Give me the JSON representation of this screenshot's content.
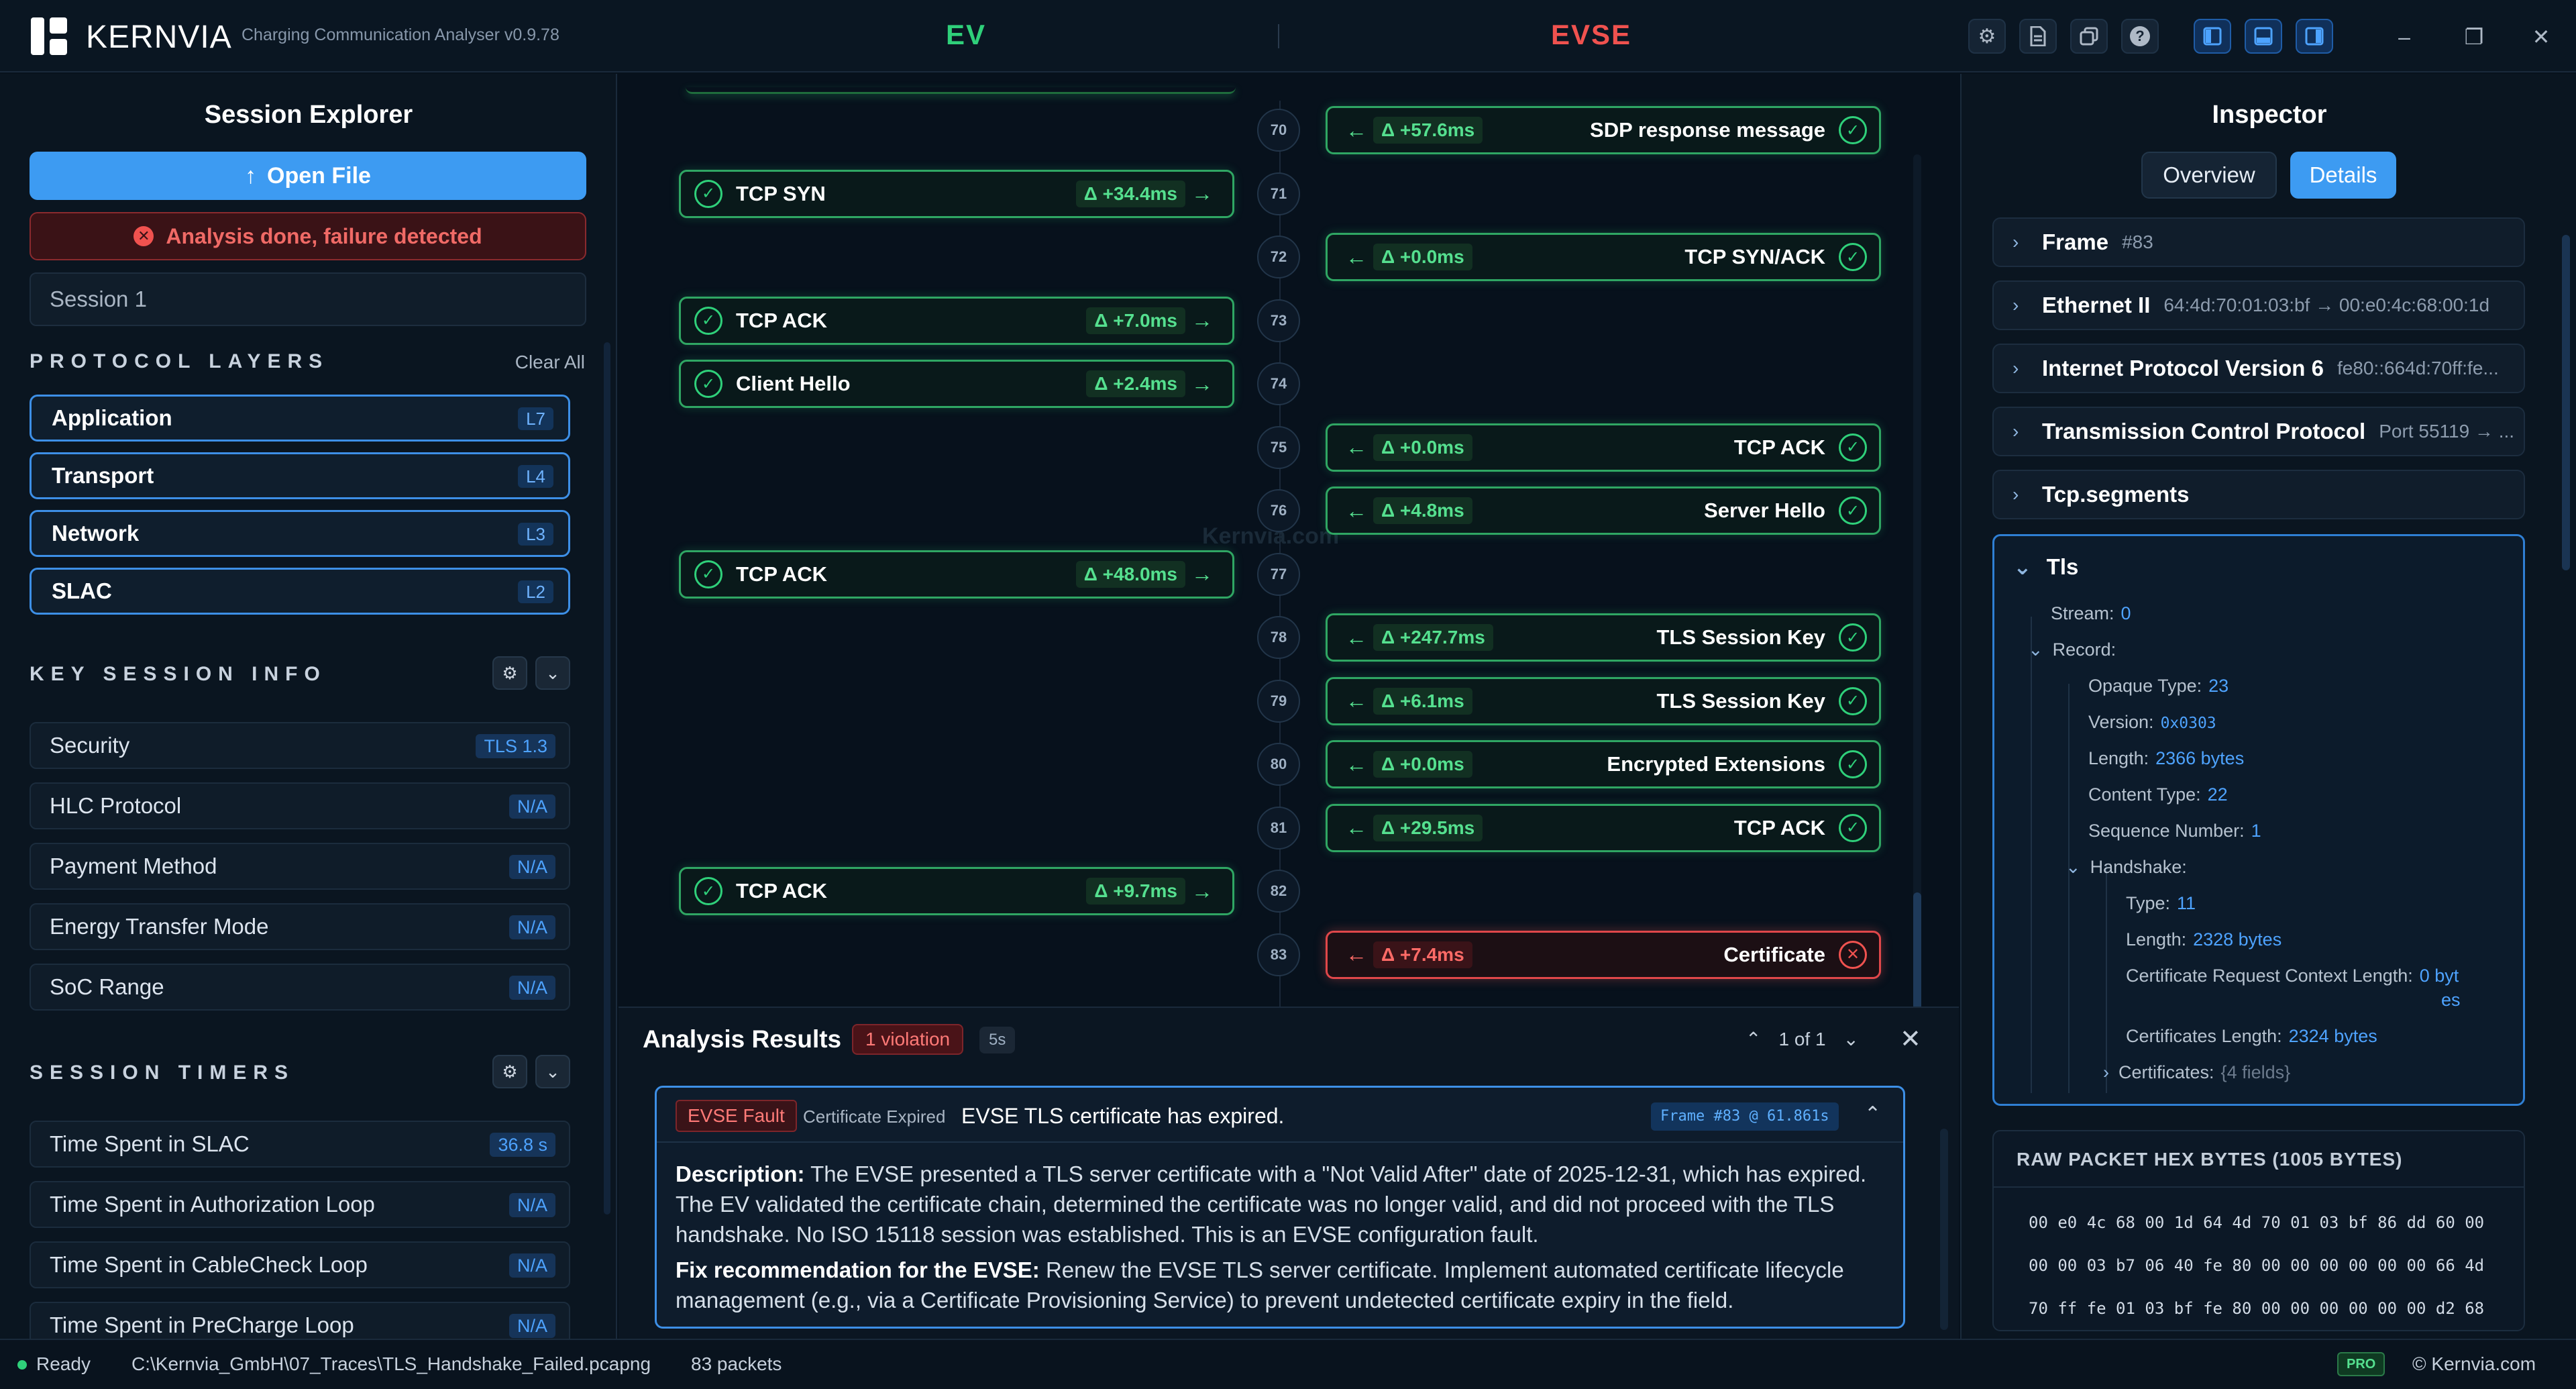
{
  "app": {
    "brand": "KERNVIA",
    "version": "Charging Communication Analyser v0.9.78",
    "ev_label": "EV",
    "evse_label": "EVSE"
  },
  "toolbar": {
    "icons": [
      "gear-icon",
      "document-icon",
      "copy-icon",
      "help-icon",
      "layout-left-icon",
      "layout-bottom-icon",
      "layout-right-icon"
    ],
    "window": {
      "minimize": "–",
      "restore": "❐",
      "close": "✕"
    }
  },
  "left": {
    "title": "Session Explorer",
    "open_file": "Open File",
    "status": "Analysis done, failure detected",
    "session": "Session 1",
    "protocol_layers_title": "PROTOCOL LAYERS",
    "clear_all": "Clear All",
    "layers": [
      {
        "name": "Application",
        "tag": "L7"
      },
      {
        "name": "Transport",
        "tag": "L4"
      },
      {
        "name": "Network",
        "tag": "L3"
      },
      {
        "name": "SLAC",
        "tag": "L2"
      }
    ],
    "key_info_title": "KEY SESSION INFO",
    "key_info": [
      {
        "name": "Security",
        "tag": "TLS 1.3"
      },
      {
        "name": "HLC Protocol",
        "tag": "N/A"
      },
      {
        "name": "Payment Method",
        "tag": "N/A"
      },
      {
        "name": "Energy Transfer Mode",
        "tag": "N/A"
      },
      {
        "name": "SoC Range",
        "tag": "N/A"
      }
    ],
    "timers_title": "SESSION TIMERS",
    "timers": [
      {
        "name": "Time Spent in SLAC",
        "tag": "36.8 s"
      },
      {
        "name": "Time Spent in Authorization Loop",
        "tag": "N/A"
      },
      {
        "name": "Time Spent in CableCheck Loop",
        "tag": "N/A"
      },
      {
        "name": "Time Spent in PreCharge Loop",
        "tag": "N/A"
      }
    ]
  },
  "sequence": {
    "watermark": "Kernvia.com",
    "frames": [
      "70",
      "71",
      "72",
      "73",
      "74",
      "75",
      "76",
      "77",
      "78",
      "79",
      "80",
      "81",
      "82",
      "83"
    ],
    "messages": [
      {
        "frame": "70",
        "side": "evse",
        "label": "SDP response message",
        "delta": "Δ +57.6ms",
        "status": "ok"
      },
      {
        "frame": "71",
        "side": "ev",
        "label": "TCP SYN",
        "delta": "Δ +34.4ms",
        "status": "ok"
      },
      {
        "frame": "72",
        "side": "evse",
        "label": "TCP SYN/ACK",
        "delta": "Δ +0.0ms",
        "status": "ok"
      },
      {
        "frame": "73",
        "side": "ev",
        "label": "TCP ACK",
        "delta": "Δ +7.0ms",
        "status": "ok"
      },
      {
        "frame": "74",
        "side": "ev",
        "label": "Client Hello",
        "delta": "Δ +2.4ms",
        "status": "ok"
      },
      {
        "frame": "75",
        "side": "evse",
        "label": "TCP ACK",
        "delta": "Δ +0.0ms",
        "status": "ok"
      },
      {
        "frame": "76",
        "side": "evse",
        "label": "Server Hello",
        "delta": "Δ +4.8ms",
        "status": "ok"
      },
      {
        "frame": "77",
        "side": "ev",
        "label": "TCP ACK",
        "delta": "Δ +48.0ms",
        "status": "ok"
      },
      {
        "frame": "78",
        "side": "evse",
        "label": "TLS Session Key",
        "delta": "Δ +247.7ms",
        "status": "ok"
      },
      {
        "frame": "79",
        "side": "evse",
        "label": "TLS Session Key",
        "delta": "Δ +6.1ms",
        "status": "ok"
      },
      {
        "frame": "80",
        "side": "evse",
        "label": "Encrypted Extensions",
        "delta": "Δ +0.0ms",
        "status": "ok"
      },
      {
        "frame": "81",
        "side": "evse",
        "label": "TCP ACK",
        "delta": "Δ +29.5ms",
        "status": "ok"
      },
      {
        "frame": "82",
        "side": "ev",
        "label": "TCP ACK",
        "delta": "Δ +9.7ms",
        "status": "ok"
      },
      {
        "frame": "83",
        "side": "evse",
        "label": "Certificate",
        "delta": "Δ +7.4ms",
        "status": "fail"
      }
    ]
  },
  "analysis": {
    "title": "Analysis Results",
    "violations": "1 violation",
    "elapsed": "5s",
    "pager": "1 of 1",
    "fault": {
      "tag": "EVSE Fault",
      "type": "Certificate Expired",
      "title": "EVSE TLS certificate has expired.",
      "frame_ref": "Frame #83 @ 61.861s",
      "description_label": "Description:",
      "description": "The EVSE presented a TLS server certificate with a \"Not Valid After\" date of 2025-12-31, which has expired. The EV validated the certificate chain, determined the certificate was no longer valid, and did not proceed with the TLS handshake. No ISO 15118 session was established. This is an EVSE configuration fault.",
      "fix_label": "Fix recommendation for the EVSE:",
      "fix": "Renew the EVSE TLS server certificate. Implement automated certificate lifecycle management (e.g., via a Certificate Provisioning Service) to prevent undetected certificate expiry in the field."
    }
  },
  "inspector": {
    "title": "Inspector",
    "tab_overview": "Overview",
    "tab_details": "Details",
    "tree": [
      {
        "name": "Frame",
        "sub": "#83"
      },
      {
        "name": "Ethernet II",
        "sub": "64:4d:70:01:03:bf → 00:e0:4c:68:00:1d"
      },
      {
        "name": "Internet Protocol Version 6",
        "sub": "fe80::664d:70ff:fe..."
      },
      {
        "name": "Transmission Control Protocol",
        "sub": "Port 55119 → ..."
      },
      {
        "name": "Tcp.segments",
        "sub": ""
      }
    ],
    "tls": {
      "name": "Tls",
      "stream_label": "Stream:",
      "stream": "0",
      "record_label": "Record:",
      "opaque_type_label": "Opaque Type:",
      "opaque_type": "23",
      "version_label": "Version:",
      "version": "0x0303",
      "length_label": "Length:",
      "length": "2366 bytes",
      "content_type_label": "Content Type:",
      "content_type": "22",
      "seq_label": "Sequence Number:",
      "seq": "1",
      "handshake_label": "Handshake:",
      "hs_type_label": "Type:",
      "hs_type": "11",
      "hs_length_label": "Length:",
      "hs_length": "2328 bytes",
      "crc_len_label": "Certificate Request Context Length:",
      "crc_len_a": "0 byt",
      "crc_len_b": "es",
      "certs_len_label": "Certificates Length:",
      "certs_len": "2324 bytes",
      "certs_label": "Certificates:",
      "certs": "{4 fields}"
    },
    "hex_title": "RAW PACKET HEX BYTES (1005 BYTES)",
    "hex_lines": [
      "00 e0 4c 68 00 1d 64 4d 70 01 03 bf 86 dd 60 00",
      "00 00 03 b7 06 40 fe 80 00 00 00 00 00 00 66 4d",
      "70 ff fe 01 03 bf fe 80 00 00 00 00 00 00 d2 68"
    ]
  },
  "status": {
    "ready": "Ready",
    "path": "C:\\Kernvia_GmbH\\07_Traces\\TLS_Handshake_Failed.pcapng",
    "packets": "83 packets",
    "pro": "PRO",
    "copyright": "© Kernvia.com"
  }
}
